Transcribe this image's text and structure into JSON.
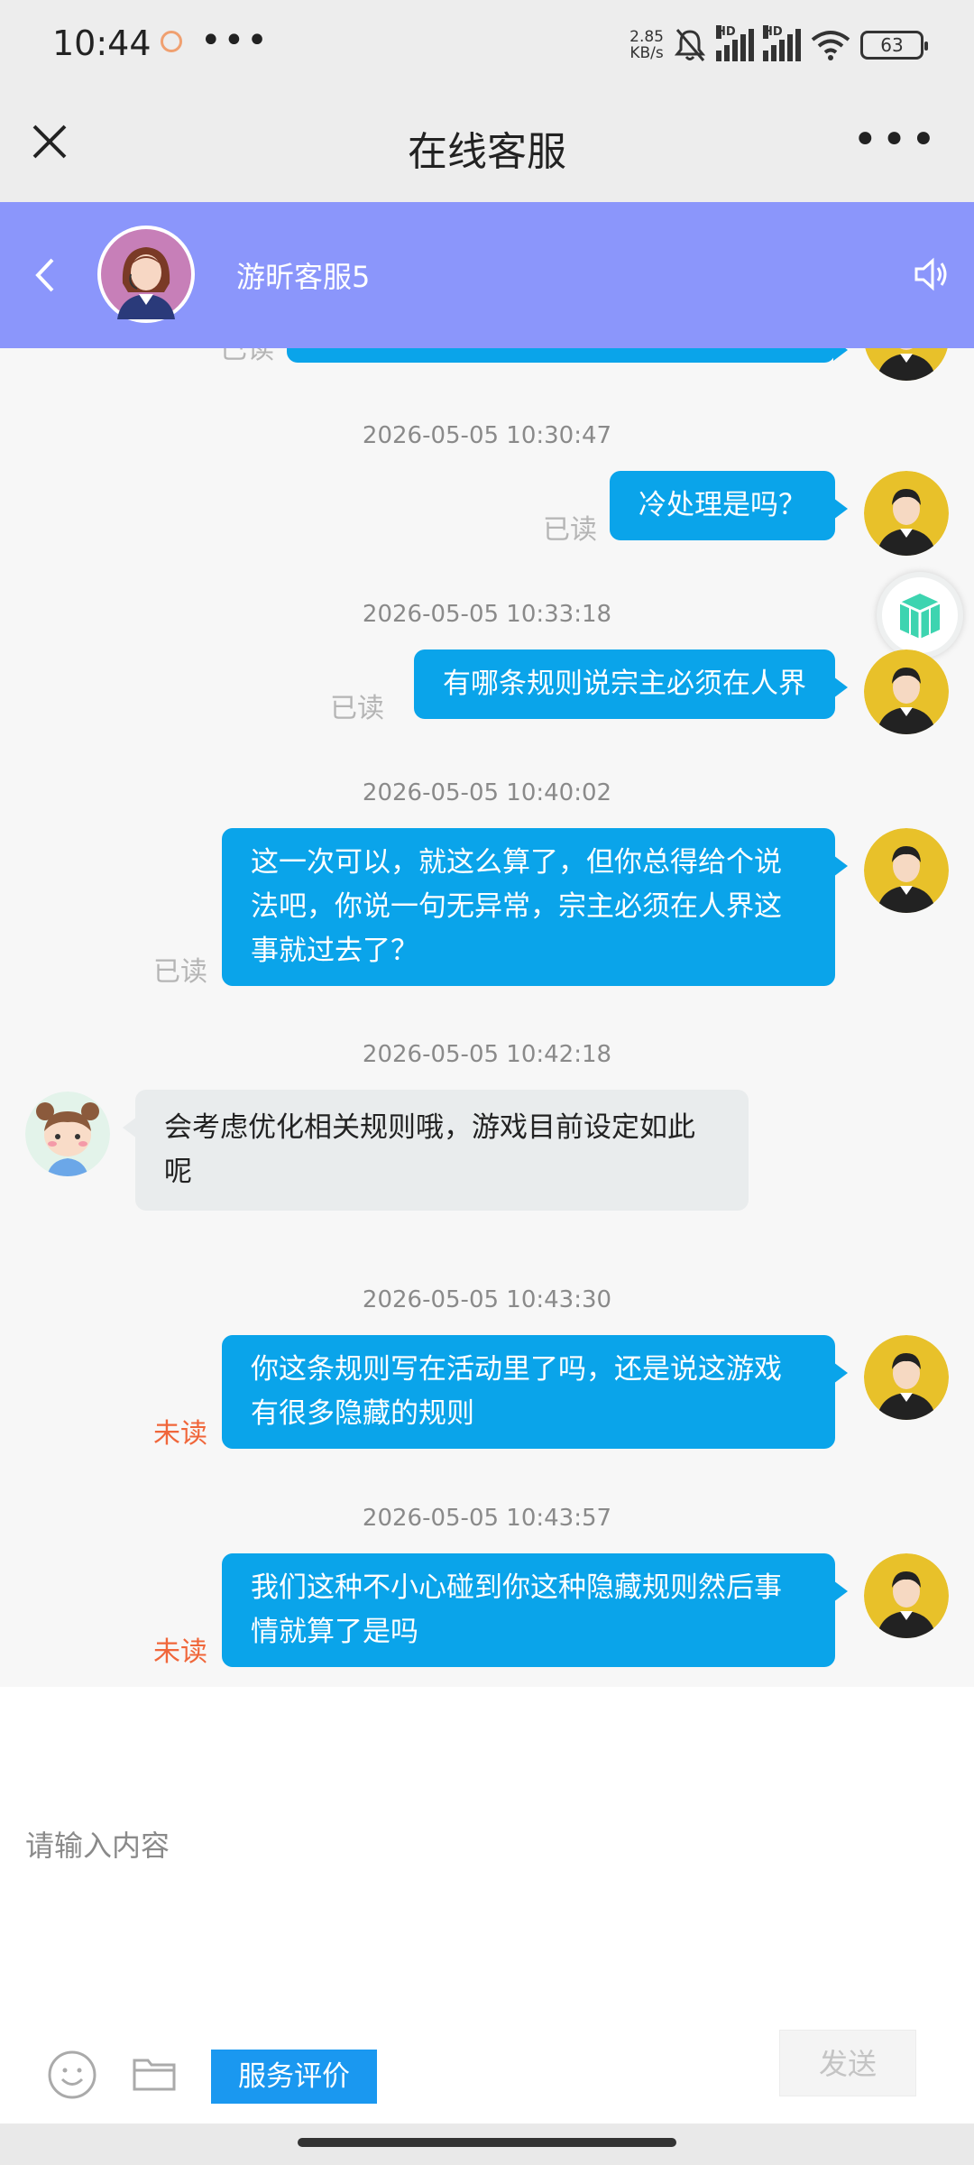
{
  "status_bar": {
    "time": "10:44",
    "more": "•••",
    "net_speed_top": "2.85",
    "net_speed_unit": "KB/s",
    "hd1": "HD",
    "hd2": "HD",
    "battery": "63"
  },
  "title_bar": {
    "title": "在线客服",
    "more": "•••"
  },
  "chat_header": {
    "agent_name": "游昕客服5"
  },
  "messages": [
    {
      "timestamp": "2026-05-05 10:30:47",
      "text": "冷处理是吗？",
      "status": "已读",
      "from": "user"
    },
    {
      "timestamp": "2026-05-05 10:33:18",
      "text": "有哪条规则说宗主必须在人界",
      "status": "已读",
      "from": "user"
    },
    {
      "timestamp": "2026-05-05 10:40:02",
      "lines": [
        "这一次可以，就这么算了，但你总得给个说",
        "法吧，你说一句无异常，宗主必须在人界这",
        "事就过去了？"
      ],
      "status": "已读",
      "from": "user"
    },
    {
      "timestamp": "2026-05-05 10:42:18",
      "lines": [
        "会考虑优化相关规则哦，游戏目前设定如此",
        "呢"
      ],
      "from": "agent"
    },
    {
      "timestamp": "2026-05-05 10:43:30",
      "lines": [
        "你这条规则写在活动里了吗，还是说这游戏",
        "有很多隐藏的规则"
      ],
      "status": "未读",
      "from": "user"
    },
    {
      "timestamp": "2026-05-05 10:43:57",
      "lines": [
        "我们这种不小心碰到你这种隐藏规则然后事",
        "情就算了是吗"
      ],
      "status": "未读",
      "from": "user"
    }
  ],
  "top_partial": {
    "status": "已读"
  },
  "input": {
    "placeholder": "请输入内容",
    "rate_label": "服务评价",
    "send_label": "发送"
  },
  "colors": {
    "header_bg": "#8b96fb",
    "user_bubble": "#0aa4ea",
    "agent_bubble": "#e9eced",
    "unread": "#f0663a",
    "rate_button": "#1a98f0"
  }
}
